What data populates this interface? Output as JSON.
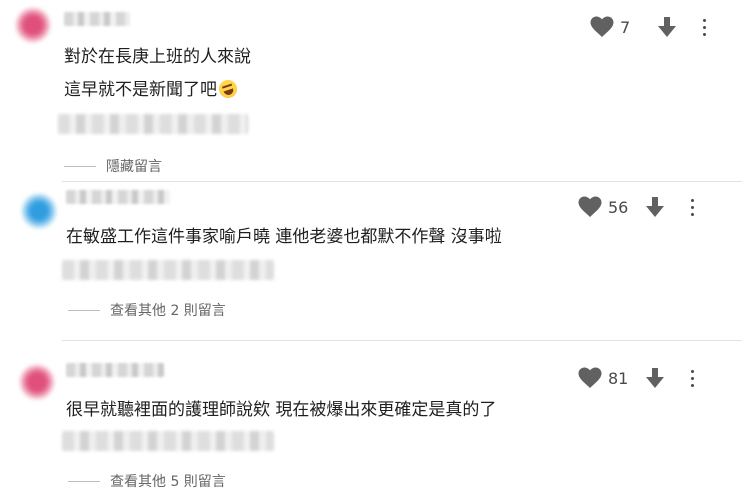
{
  "comments": [
    {
      "text_lines": [
        "對於在長庚上班的人來說",
        "這早就不是新聞了吧"
      ],
      "likes": "7",
      "reply_toggle": "隱藏留言",
      "avatar_color": "#e0507c"
    },
    {
      "text_lines": [
        "在敏盛工作這件事家喻戶曉 連他老婆也都默不作聲 沒事啦"
      ],
      "likes": "56",
      "reply_toggle": "查看其他 2 則留言",
      "avatar_color": "#2f9de0"
    },
    {
      "text_lines": [
        "很早就聽裡面的護理師說欸 現在被爆出來更確定是真的了"
      ],
      "likes": "81",
      "reply_toggle": "查看其他 5 則留言",
      "avatar_color": "#e0507c"
    }
  ],
  "icons": {
    "like": "heart-icon",
    "dislike": "arrow-down-icon",
    "menu": "more-vertical-icon",
    "emoji": "rolling-on-floor-laughing-emoji"
  }
}
